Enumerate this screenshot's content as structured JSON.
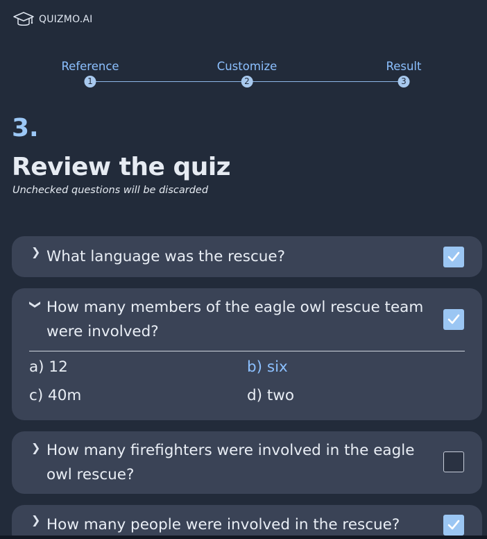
{
  "brand": {
    "name": "QUIZMO.AI",
    "icon": "graduation-cap-icon"
  },
  "stepper": {
    "steps": [
      {
        "label": "Reference",
        "number": "1"
      },
      {
        "label": "Customize",
        "number": "2"
      },
      {
        "label": "Result",
        "number": "3"
      }
    ]
  },
  "page": {
    "step_number": "3.",
    "title": "Review the quiz",
    "subtitle": "Unchecked questions will be discarded"
  },
  "questions": [
    {
      "text": "What language was the rescue?",
      "checked": true,
      "expanded": false
    },
    {
      "text": "How many members of the eagle owl rescue team were involved?",
      "checked": true,
      "expanded": true,
      "answers": [
        {
          "label": "a) 12",
          "correct": false
        },
        {
          "label": "b) six",
          "correct": true
        },
        {
          "label": "c) 40m",
          "correct": false
        },
        {
          "label": "d) two",
          "correct": false
        }
      ]
    },
    {
      "text": "How many firefighters were involved in the eagle owl rescue?",
      "checked": false,
      "expanded": false
    },
    {
      "text": "How many people were involved in the rescue?",
      "checked": true,
      "expanded": false
    }
  ],
  "colors": {
    "background": "#222b3a",
    "card": "#3a4356",
    "accent": "#8cc0ff",
    "checkbox": "#9bc6f3"
  }
}
